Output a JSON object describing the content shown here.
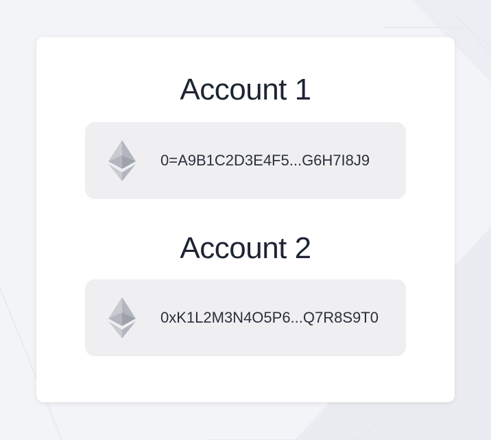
{
  "accounts": [
    {
      "title": "Account 1",
      "address": "0=A9B1C2D3E4F5...G6H7I8J9",
      "icon": "ethereum-icon"
    },
    {
      "title": "Account 2",
      "address": "0xK1L2M3N4O5P6...Q7R8S9T0",
      "icon": "ethereum-icon"
    }
  ],
  "colors": {
    "background": "#f3f4f7",
    "card": "#ffffff",
    "address_box": "#efeff2",
    "text": "#1d2433"
  }
}
